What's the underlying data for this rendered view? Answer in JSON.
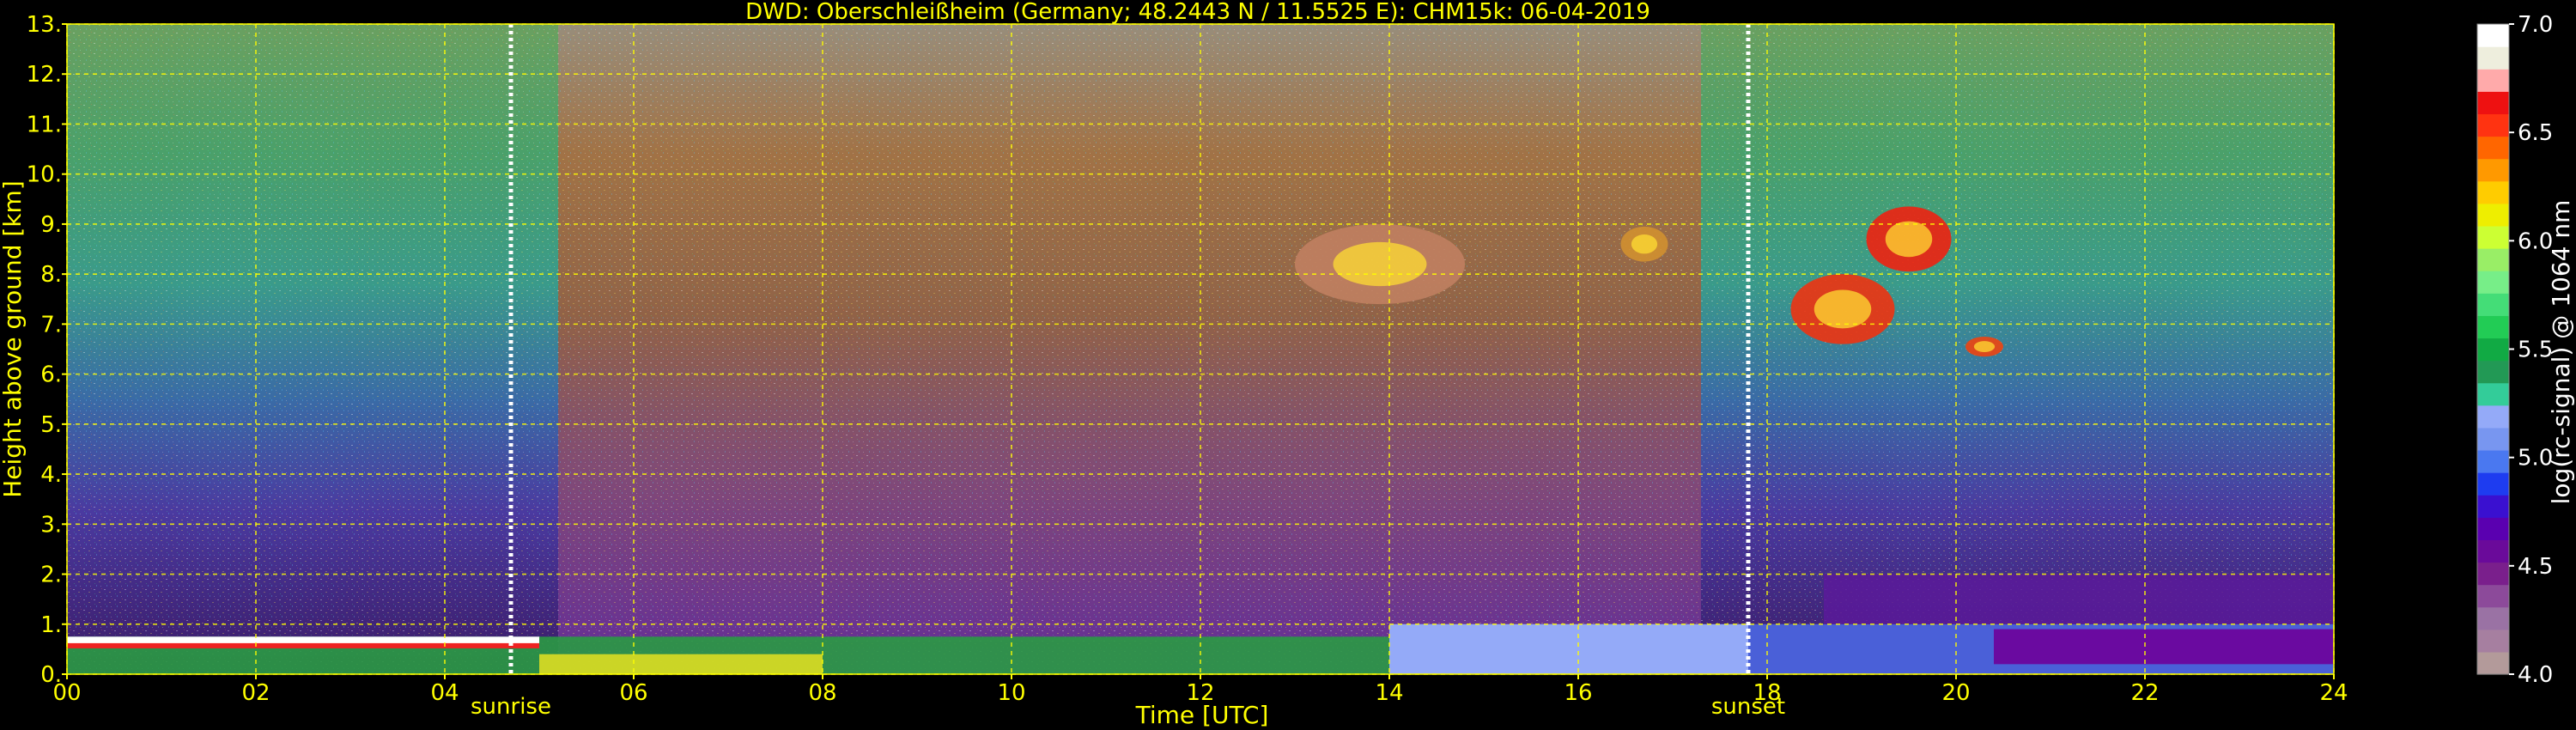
{
  "chart_data": {
    "type": "heatmap",
    "title": "DWD: Oberschleißheim (Germany; 48.2443 N / 11.5525 E):    CHM15k: 06-04-2019",
    "xlabel": "Time [UTC]",
    "ylabel": "Height above ground [km]",
    "xlim": [
      0,
      24
    ],
    "ylim": [
      0,
      13
    ],
    "x_ticks": [
      0,
      2,
      4,
      6,
      8,
      10,
      12,
      14,
      16,
      18,
      20,
      22,
      24
    ],
    "x_tick_labels": [
      "00",
      "02",
      "04",
      "06",
      "08",
      "10",
      "12",
      "14",
      "16",
      "18",
      "20",
      "22",
      "24"
    ],
    "y_ticks": [
      0,
      1,
      2,
      3,
      4,
      5,
      6,
      7,
      8,
      9,
      10,
      11,
      12,
      13
    ],
    "y_tick_labels": [
      "0.",
      "1.",
      "2.",
      "3.",
      "4.",
      "5.",
      "6.",
      "7.",
      "8.",
      "9.",
      "10.",
      "11.",
      "12.",
      "13."
    ],
    "grid": true,
    "markers": [
      {
        "label": "sunrise",
        "x": 4.7
      },
      {
        "label": "sunset",
        "x": 17.8
      }
    ],
    "colorbar": {
      "label": "log(rc-signal) @ 1064 nm",
      "min": 4.0,
      "max": 7.0,
      "ticks": [
        4.0,
        4.5,
        5.0,
        5.5,
        6.0,
        6.5,
        7.0
      ],
      "tick_labels": [
        "4.0",
        "4.5",
        "5.0",
        "5.5",
        "6.0",
        "6.5",
        "7.0"
      ],
      "colors": [
        "#b39a9a",
        "#a67fa0",
        "#9a72a4",
        "#8c4a9a",
        "#7a1f8c",
        "#6a0a9a",
        "#5a00b0",
        "#3a10d0",
        "#1e3cf0",
        "#4a78f0",
        "#7896f0",
        "#94aaf8",
        "#33cc99",
        "#229955",
        "#11aa44",
        "#22cc55",
        "#44dd77",
        "#77ee88",
        "#99ee66",
        "#ccff33",
        "#eeee00",
        "#ffcc00",
        "#ff9900",
        "#ff6600",
        "#ff3311",
        "#ee1111",
        "#ffaaaa",
        "#eeeedd",
        "#ffffff"
      ]
    }
  }
}
